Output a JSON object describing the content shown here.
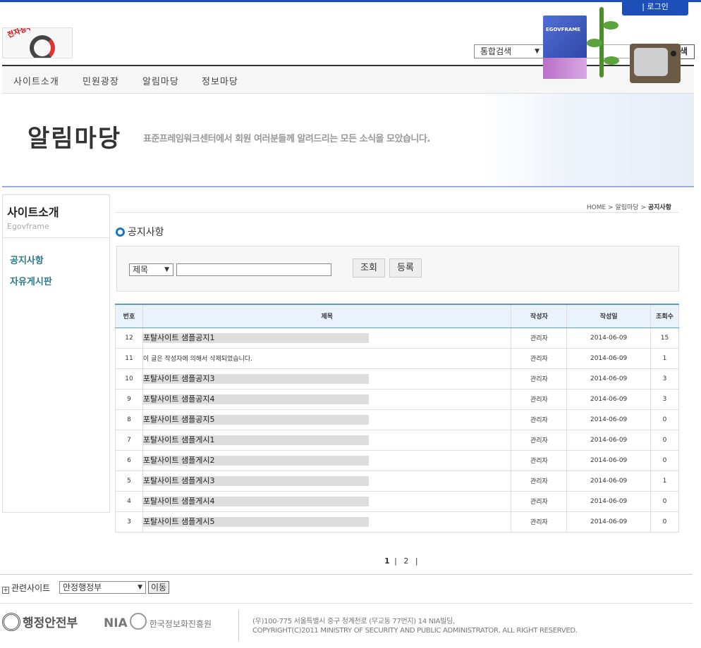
{
  "header": {
    "login_label": "| 로그인",
    "logo_text": "전자정부 표준프레임워크",
    "search_scope": "통합검색",
    "search_button": "검색"
  },
  "gnb": [
    "사이트소개",
    "민원광장",
    "알림마당",
    "정보마당"
  ],
  "visual": {
    "title": "알림마당",
    "description": "표준프레임워크센터에서 회원 여러분들께 알려드리는 모든 소식을 모았습니다.",
    "box_label": "EGOVFRAME"
  },
  "lnb": {
    "title": "사이트소개",
    "subtitle": "Egovframe",
    "items": [
      "공지사항",
      "자유게시판"
    ]
  },
  "location": {
    "home": "HOME",
    "sep": ">",
    "parent": "알림마당",
    "current": "공지사항"
  },
  "board": {
    "title": "공지사항",
    "search_field": "제목",
    "search_button": "조회",
    "write_button": "등록",
    "columns": [
      "번호",
      "제목",
      "작성자",
      "작성일",
      "조회수"
    ],
    "rows": [
      {
        "no": "12",
        "title": "포탈사이트 샘플공지1",
        "author": "관리자",
        "date": "2014-06-09",
        "views": "15",
        "deleted": false
      },
      {
        "no": "11",
        "title": "이 글은 작성자에 의해서 삭제되었습니다.",
        "author": "관리자",
        "date": "2014-06-09",
        "views": "1",
        "deleted": true
      },
      {
        "no": "10",
        "title": "포탈사이트 샘플공지3",
        "author": "관리자",
        "date": "2014-06-09",
        "views": "3",
        "deleted": false
      },
      {
        "no": "9",
        "title": "포탈사이트 샘플공지4",
        "author": "관리자",
        "date": "2014-06-09",
        "views": "3",
        "deleted": false
      },
      {
        "no": "8",
        "title": "포탈사이트 샘플공지5",
        "author": "관리자",
        "date": "2014-06-09",
        "views": "0",
        "deleted": false
      },
      {
        "no": "7",
        "title": "포탈사이트 샘플게시1",
        "author": "관리자",
        "date": "2014-06-09",
        "views": "0",
        "deleted": false
      },
      {
        "no": "6",
        "title": "포탈사이트 샘플게시2",
        "author": "관리자",
        "date": "2014-06-09",
        "views": "0",
        "deleted": false
      },
      {
        "no": "5",
        "title": "포탈사이트 샘플게시3",
        "author": "관리자",
        "date": "2014-06-09",
        "views": "1",
        "deleted": false
      },
      {
        "no": "4",
        "title": "포탈사이트 샘플게시4",
        "author": "관리자",
        "date": "2014-06-09",
        "views": "0",
        "deleted": false
      },
      {
        "no": "3",
        "title": "포탈사이트 샘플게시5",
        "author": "관리자",
        "date": "2014-06-09",
        "views": "0",
        "deleted": false
      }
    ],
    "pages": [
      "1",
      "2"
    ],
    "current_page": "1"
  },
  "footer": {
    "related_label": "관련사이트",
    "related_site": "안정행정부",
    "go_button": "이동",
    "org1": "행정안전부",
    "org2": "NIA",
    "org2_kr": "한국정보화진흥원",
    "address": "(우)100-775 서울특별시 중구 청계천로 (무교동 77번지) 14 NIA빌딩,",
    "copyright": "COPYRIGHT(C)2011 MINISTRY OF SECURITY AND PUBLIC ADMINISTRATOR, ALL RIGHT RESERVED."
  },
  "colors": {
    "accent": "#1c4fb8",
    "table_header_border": "#5b9bd5",
    "lnb_link": "#2c7a8a"
  }
}
